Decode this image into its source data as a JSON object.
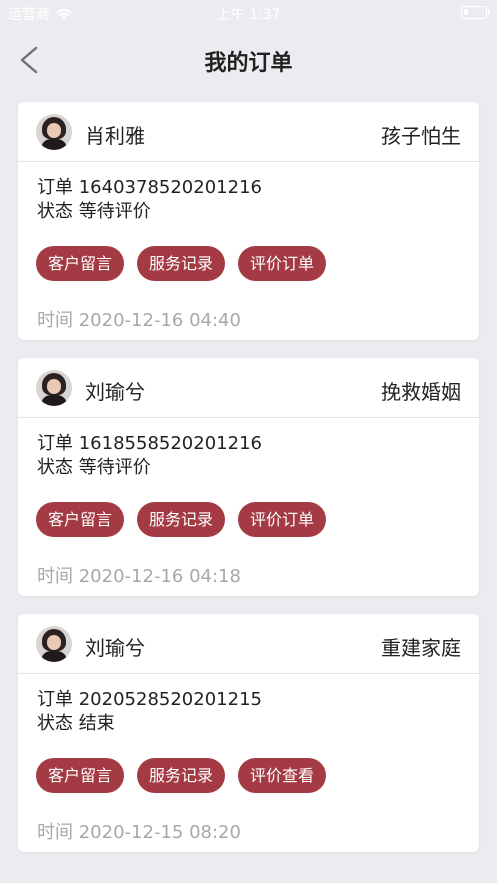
{
  "status_bar": {
    "carrier": "运营商",
    "time": "上午 1:37"
  },
  "header": {
    "title": "我的订单"
  },
  "labels": {
    "order_prefix": "订单",
    "status_prefix": "状态",
    "time_prefix": "时间"
  },
  "orders": [
    {
      "consultant": "肖利雅",
      "service": "孩子怕生",
      "order_no": "1640378520201216",
      "status": "等待评价",
      "actions": [
        "客户留言",
        "服务记录",
        "评价订单"
      ],
      "time": "2020-12-16 04:40"
    },
    {
      "consultant": "刘瑜兮",
      "service": "挽救婚姻",
      "order_no": "1618558520201216",
      "status": "等待评价",
      "actions": [
        "客户留言",
        "服务记录",
        "评价订单"
      ],
      "time": "2020-12-16 04:18"
    },
    {
      "consultant": "刘瑜兮",
      "service": "重建家庭",
      "order_no": "2020528520201215",
      "status": "结束",
      "actions": [
        "客户留言",
        "服务记录",
        "评价查看"
      ],
      "time": "2020-12-15 08:20"
    }
  ],
  "colors": {
    "accent": "#a33a44",
    "background": "#ececf0"
  }
}
